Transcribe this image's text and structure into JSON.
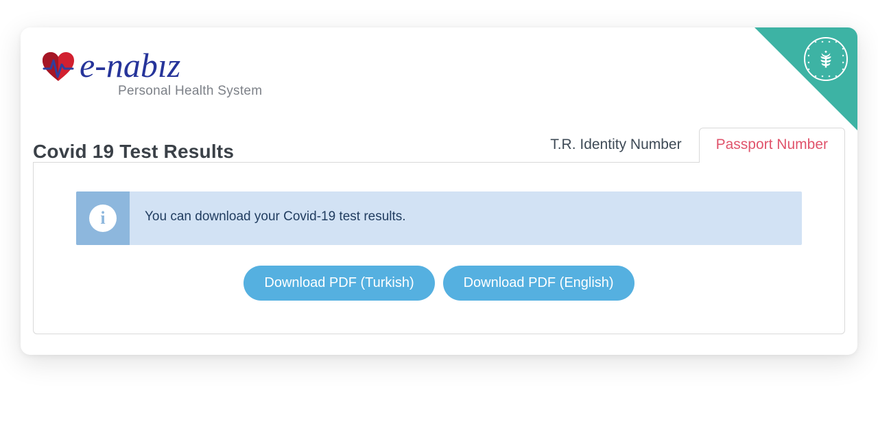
{
  "brand": {
    "logo_text": "e-nabız",
    "tagline": "Personal Health System"
  },
  "page": {
    "title": "Covid 19 Test Results"
  },
  "tabs": {
    "identity": "T.R. Identity Number",
    "passport": "Passport Number",
    "active": "passport"
  },
  "info": {
    "message": "You can download your Covid-19 test results."
  },
  "buttons": {
    "download_tr": "Download PDF (Turkish)",
    "download_en": "Download PDF (English)"
  },
  "colors": {
    "accent_teal": "#3db3a4",
    "tab_active_text": "#e0546c",
    "button_bg": "#55b0e0",
    "info_bg": "#d2e2f4",
    "info_icon_bg": "#8db7dd"
  }
}
